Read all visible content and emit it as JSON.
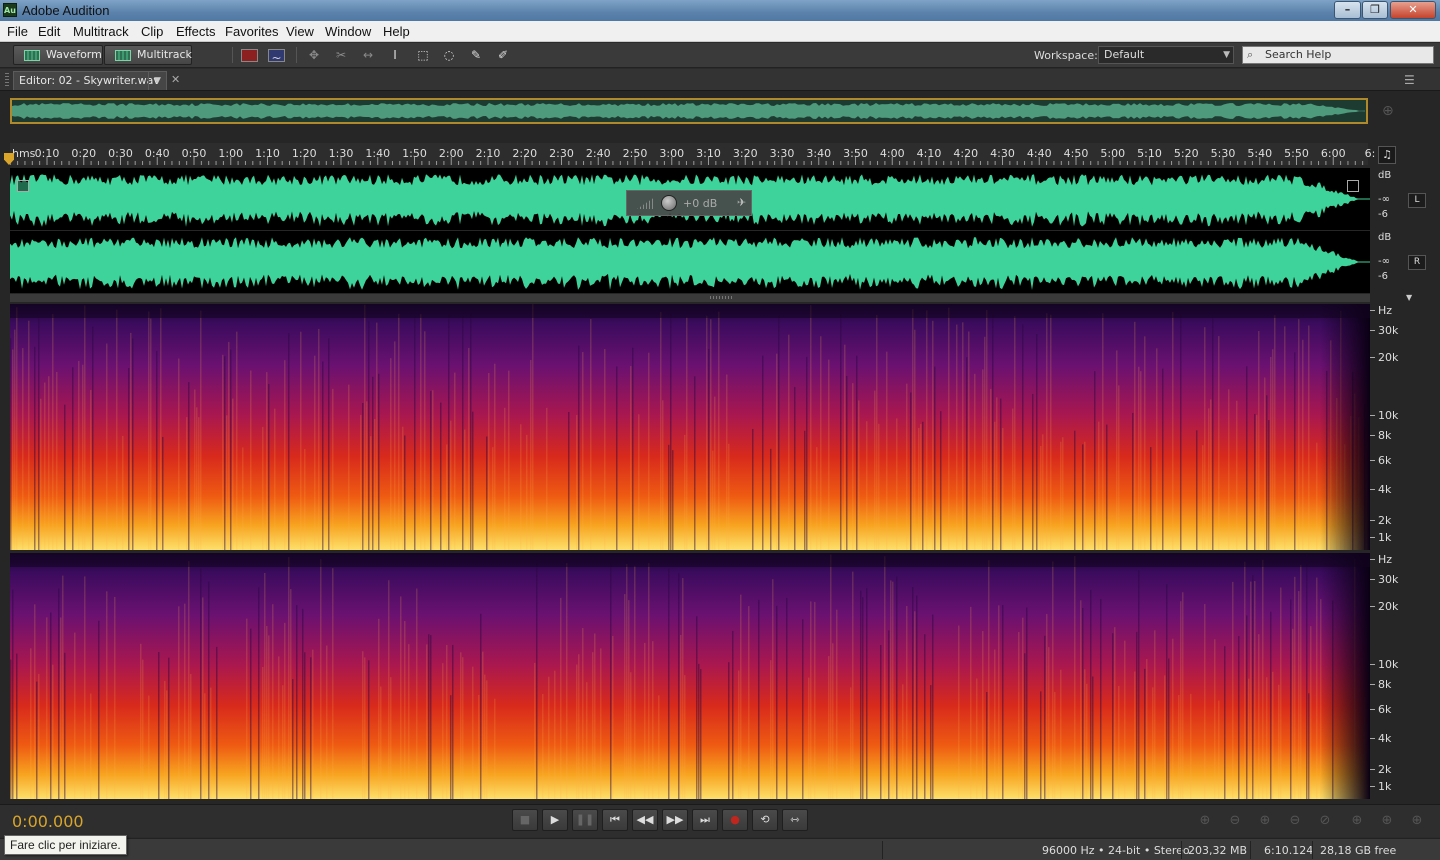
{
  "window": {
    "title": "Adobe Audition",
    "app_icon": "Au"
  },
  "menu": [
    "File",
    "Edit",
    "Multitrack",
    "Clip",
    "Effects",
    "Favorites",
    "View",
    "Window",
    "Help"
  ],
  "toolbar": {
    "waveform_label": "Waveform",
    "multitrack_label": "Multitrack",
    "workspace_label": "Workspace:",
    "workspace_value": "Default",
    "search_placeholder": "Search Help"
  },
  "editor": {
    "tab_label": "Editor: 02 - Skywriter.wav",
    "time_units": "hms",
    "ruler_ticks": [
      "0:10",
      "0:20",
      "0:30",
      "0:40",
      "0:50",
      "1:00",
      "1:10",
      "1:20",
      "1:30",
      "1:40",
      "1:50",
      "2:00",
      "2:10",
      "2:20",
      "2:30",
      "2:40",
      "2:50",
      "3:00",
      "3:10",
      "3:20",
      "3:30",
      "3:40",
      "3:50",
      "4:00",
      "4:10",
      "4:20",
      "4:30",
      "4:40",
      "4:50",
      "5:00",
      "5:10",
      "5:20",
      "5:30",
      "5:40",
      "5:50",
      "6:00",
      "6:"
    ],
    "hud_gain": "+0 dB",
    "db_scale": {
      "unit": "dB",
      "inf": "-∞",
      "minus6": "-6"
    },
    "channels": [
      "L",
      "R"
    ],
    "hz_scale": [
      "Hz",
      "30k",
      "20k",
      "10k",
      "8k",
      "6k",
      "4k",
      "2k",
      "1k"
    ]
  },
  "transport": {
    "current_time": "0:00.000",
    "buttons": [
      "stop",
      "play",
      "pause",
      "move-to-previous",
      "rewind",
      "fast-forward",
      "move-to-next",
      "record",
      "loop",
      "skip-selection"
    ]
  },
  "status": {
    "tooltip": "Fare clic per iniziare.",
    "format": "96000 Hz • 24-bit • Stereo",
    "file_size": "203,32 MB",
    "duration": "6:10.124",
    "free_space": "28,18 GB free"
  },
  "colors": {
    "waveform": "#3ed39a",
    "timecode": "#d9a52a",
    "accent_bar": "#b08a2a"
  }
}
